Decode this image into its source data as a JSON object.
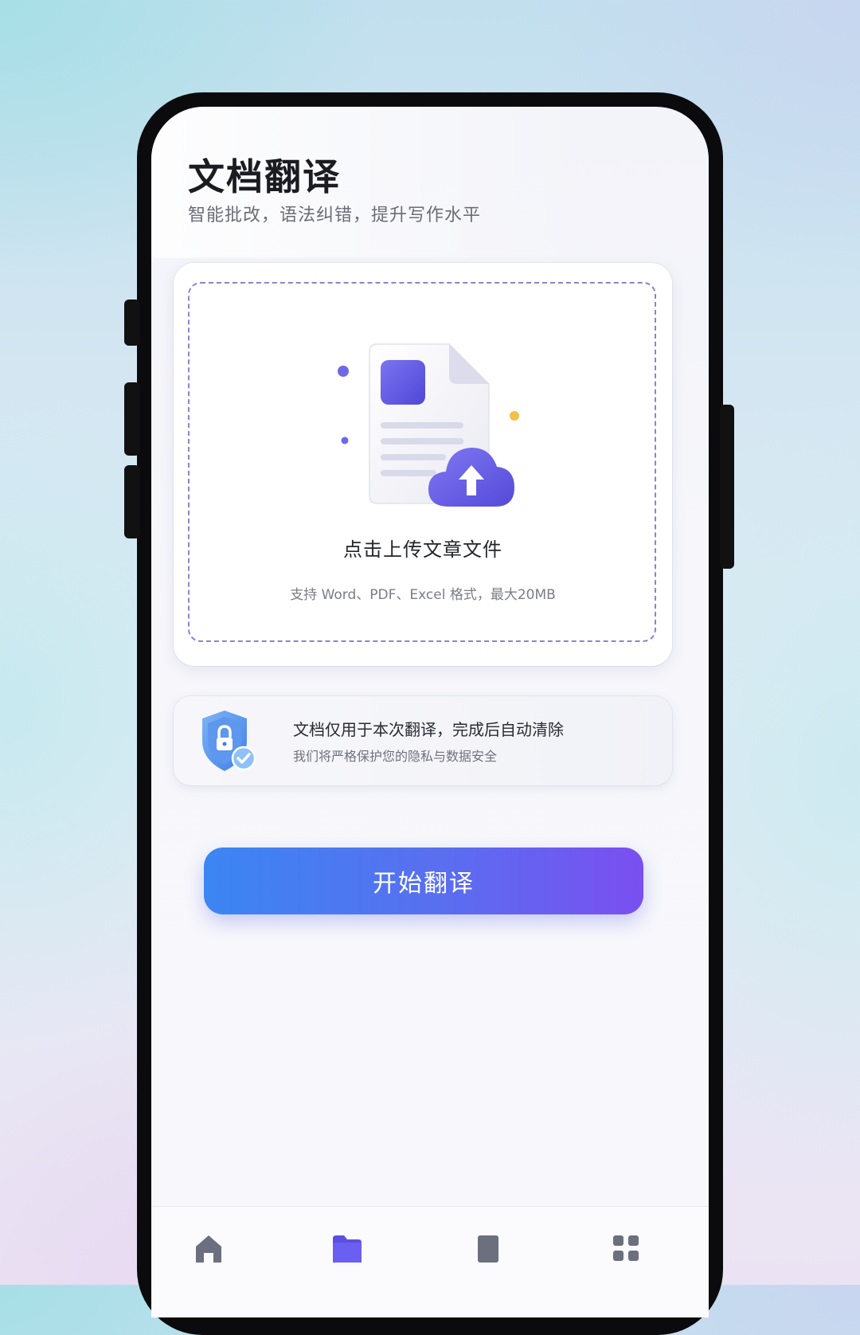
{
  "header": {
    "title": "文档翻译",
    "subtitle": "智能批改，语法纠错，提升写作水平"
  },
  "upload": {
    "title": "点击上传文章文件",
    "hint": "支持 Word、PDF、Excel 格式，最大20MB",
    "icon": "document-upload-icon"
  },
  "privacy": {
    "main": "文档仅用于本次翻译，完成后自动清除",
    "sub": "我们将严格保护您的隐私与数据安全",
    "icon": "shield-lock-icon"
  },
  "actions": {
    "start_label": "开始翻译"
  },
  "tabbar": {
    "items": [
      {
        "icon": "home-icon",
        "active": false
      },
      {
        "icon": "folder-icon",
        "active": true
      },
      {
        "icon": "document-icon",
        "active": false
      },
      {
        "icon": "grid-icon",
        "active": false
      }
    ]
  },
  "colors": {
    "accent_start": "#3b86f2",
    "accent_end": "#7a4ff0",
    "dash": "#8a84cf"
  }
}
